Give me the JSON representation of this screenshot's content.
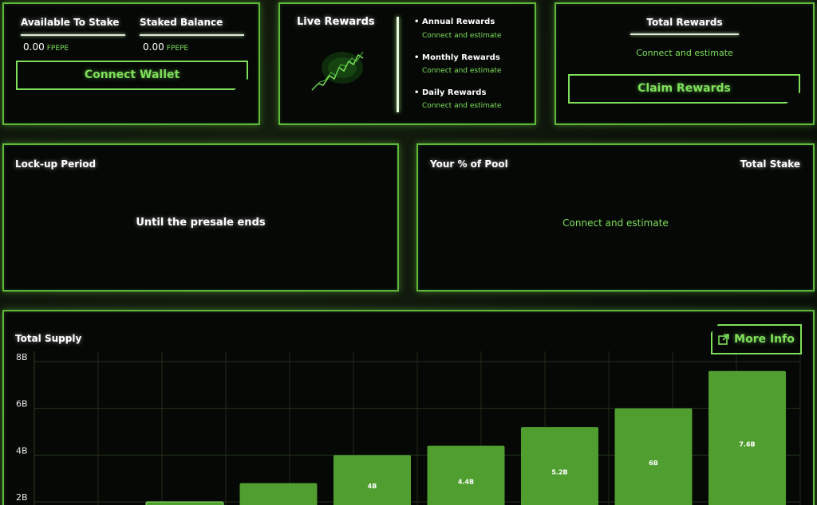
{
  "staking": {
    "available_label": "Available To Stake",
    "available_value": "0.00",
    "available_unit": "FPEPE",
    "staked_label": "Staked Balance",
    "staked_value": "0.00",
    "staked_unit": "FPEPE",
    "connect_label": "Connect Wallet"
  },
  "live_rewards": {
    "title": "Live Rewards",
    "items": [
      {
        "label": "Annual Rewards",
        "sub": "Connect and estimate"
      },
      {
        "label": "Monthly Rewards",
        "sub": "Connect and estimate"
      },
      {
        "label": "Daily Rewards",
        "sub": "Connect and estimate"
      }
    ]
  },
  "total_rewards": {
    "title": "Total Rewards",
    "sub": "Connect and estimate",
    "claim_label": "Claim Rewards"
  },
  "lockup": {
    "title": "Lock-up Period",
    "value": "Until the presale ends"
  },
  "pool": {
    "title": "Your % of Pool",
    "total_label": "Total Stake",
    "value": "Connect and estimate"
  },
  "supply": {
    "title": "Total Supply",
    "more_label": "More Info"
  },
  "colors": {
    "accent": "#7ee05a",
    "bar": "#4f9e2f",
    "border": "#5fb83a"
  },
  "chart_data": {
    "type": "bar",
    "title": "Total Supply",
    "ylim": [
      0,
      8
    ],
    "y_ticks": [
      "2B",
      "4B",
      "6B",
      "8B"
    ],
    "grid": true,
    "values": [
      2.0,
      2.8,
      4.0,
      4.4,
      5.2,
      6.0,
      7.6
    ],
    "bar_labels": [
      "",
      "",
      "4B",
      "4.4B",
      "5.2B",
      "6B",
      "7.6B"
    ]
  }
}
